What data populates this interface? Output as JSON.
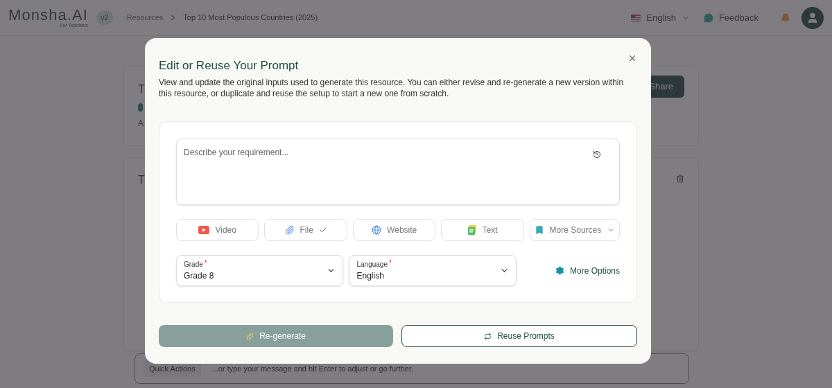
{
  "header": {
    "logo": "Monsha.AI",
    "logo_tagline": "For Teachers",
    "version": "v2",
    "breadcrumb": [
      "Resources",
      "Top 10 Most Populous Countries (2025)"
    ],
    "language": "English",
    "feedback": "Feedback"
  },
  "background": {
    "card_title": "T",
    "card_subtitle": "A",
    "share": "Share",
    "section_title": "T",
    "quick_actions": "Quick Actions",
    "chat_placeholder": "...or type your message and hit Enter to adjust or go further."
  },
  "dialog": {
    "title": "Edit or Reuse Your Prompt",
    "description": "View and update the original inputs used to generate this resource. You can either revise and re-generate a new version within this resource, or duplicate and reuse the setup to start a new one from scratch.",
    "prompt": {
      "placeholder": "Describe your requirement..."
    },
    "sources": [
      {
        "kind": "video",
        "label": "Video",
        "checked": false
      },
      {
        "kind": "file",
        "label": "File",
        "checked": true
      },
      {
        "kind": "website",
        "label": "Website",
        "checked": false
      },
      {
        "kind": "text",
        "label": "Text",
        "checked": false
      },
      {
        "kind": "more",
        "label": "More Sources",
        "checked": false
      }
    ],
    "selects": [
      {
        "label": "Grade",
        "required_mark": "*",
        "value": "Grade 8"
      },
      {
        "label": "Language",
        "required_mark": "*",
        "value": "English"
      }
    ],
    "more_options": "More Options",
    "buttons": [
      {
        "kind": "primary",
        "label": "Re-generate",
        "disabled": true
      },
      {
        "kind": "secondary",
        "label": "Reuse Prompts",
        "disabled": false
      }
    ]
  }
}
